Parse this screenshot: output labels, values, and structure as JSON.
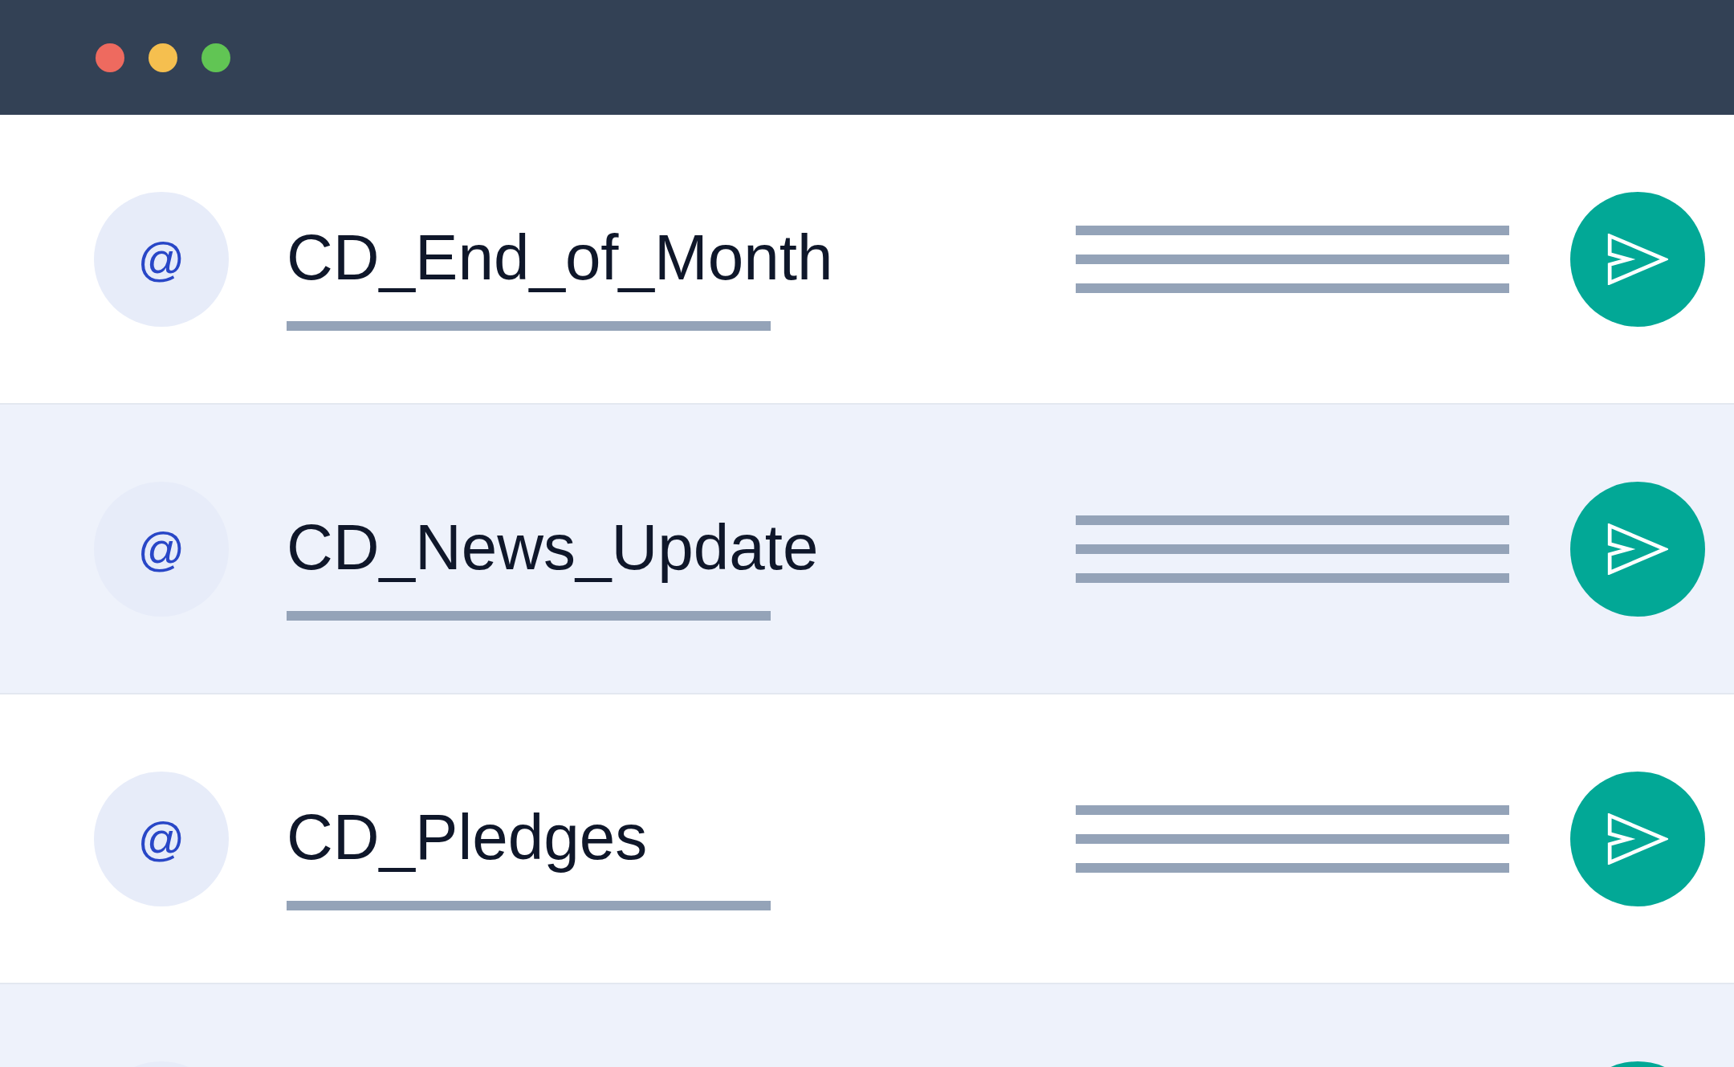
{
  "window": {
    "controls": [
      {
        "color": "#ee6a5f"
      },
      {
        "color": "#f5bf4f"
      },
      {
        "color": "#61c554"
      }
    ]
  },
  "list": {
    "items": [
      {
        "kind": "entry",
        "symbol": "@",
        "title": "CD_End_of_Month"
      },
      {
        "kind": "entry",
        "symbol": "@",
        "title": "CD_News_Update"
      },
      {
        "kind": "entry",
        "symbol": "@",
        "title": "CD_Pledges"
      },
      {
        "kind": "entry"
      }
    ]
  }
}
